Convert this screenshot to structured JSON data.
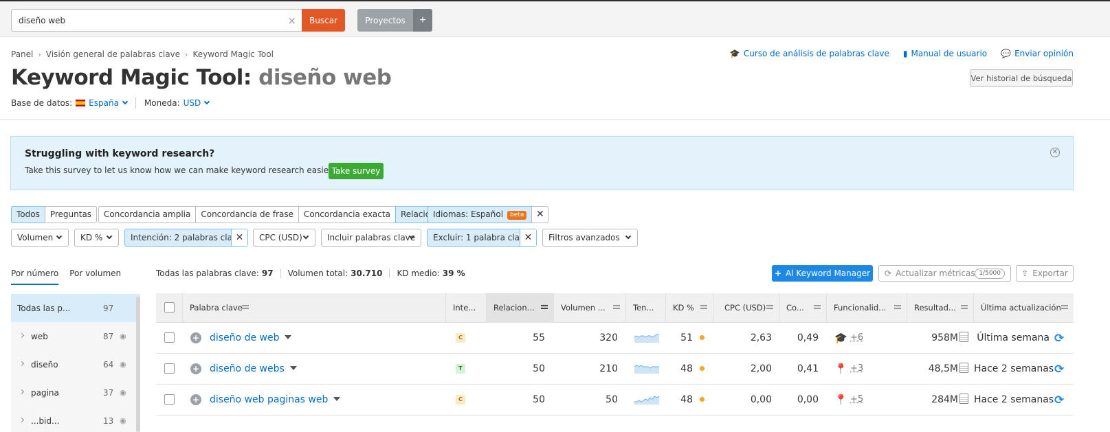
{
  "topbar": {
    "search_value": "diseño web",
    "search_button": "Buscar",
    "projects_button": "Proyectos",
    "plus_button": "+"
  },
  "breadcrumb": [
    "Panel",
    "Visión general de palabras clave",
    "Keyword Magic Tool"
  ],
  "top_links": {
    "course": "Curso de análisis de palabras clave",
    "manual": "Manual de usuario",
    "feedback": "Enviar opinión"
  },
  "title": {
    "tool": "Keyword Magic Tool:",
    "keyword": "diseño web"
  },
  "history_button": "Ver historial de búsqueda",
  "database": {
    "label": "Base de datos:",
    "value": "España",
    "currency_label": "Moneda:",
    "currency_value": "USD"
  },
  "banner": {
    "title": "Struggling with keyword research?",
    "text": "Take this survey to let us know how we can make keyword research easier for you.",
    "button": "Take survey"
  },
  "match_tabs": [
    "Todos",
    "Preguntas"
  ],
  "match_types": [
    "Concordancia amplia",
    "Concordancia de frase",
    "Concordancia exacta",
    "Relacionadas"
  ],
  "language_filter": {
    "label": "Idiomas: Español",
    "badge": "beta"
  },
  "filters": {
    "volume": "Volumen",
    "kd": "KD %",
    "intent": "Intención: 2 palabras clave",
    "cpc": "CPC (USD)",
    "include": "Incluir palabras clave",
    "exclude": "Excluir: 1 palabra clave",
    "advanced": "Filtros avanzados"
  },
  "left_tabs": [
    "Por número",
    "Por volumen"
  ],
  "groups": [
    {
      "label": "Todas las p...",
      "count": "97"
    },
    {
      "label": "web",
      "count": "87"
    },
    {
      "label": "diseño",
      "count": "64"
    },
    {
      "label": "pagina",
      "count": "37"
    },
    {
      "label": "...bid...",
      "count": "13"
    }
  ],
  "summary": {
    "all_label": "Todas las palabras clave:",
    "all_value": "97",
    "volume_label": "Volumen total:",
    "volume_value": "30.710",
    "kd_label": "KD medio:",
    "kd_value": "39 %"
  },
  "actions": {
    "keyword_manager": "Al Keyword Manager",
    "update_metrics": "Actualizar métricas",
    "quota": "1/5000",
    "export": "Exportar"
  },
  "columns": [
    "Palabra clave",
    "Inte...",
    "Relacion...",
    "Volumen ...",
    "Ten...",
    "KD %",
    "CPC (USD)",
    "Co...",
    "Funcionalid...",
    "Resultad...",
    "Última actualización"
  ],
  "rows": [
    {
      "keyword": "diseño de web",
      "intent": "C",
      "relevance": "55",
      "volume": "320",
      "kd": "51",
      "cpc": "2,63",
      "com": "0,49",
      "serp_icon": "graduation-cap-icon",
      "serp_more": "+6",
      "results": "958M",
      "updated": "Última semana",
      "trend": [
        4,
        5,
        4,
        5,
        5,
        4,
        5,
        5,
        4,
        5,
        6,
        6
      ]
    },
    {
      "keyword": "diseño de webs",
      "intent": "T",
      "relevance": "50",
      "volume": "210",
      "kd": "48",
      "cpc": "2,00",
      "com": "0,41",
      "serp_icon": "map-pin-icon",
      "serp_more": "+3",
      "results": "48,5M",
      "updated": "Hace 2 semanas",
      "trend": [
        5,
        6,
        5,
        6,
        5,
        5,
        5,
        4,
        5,
        5,
        5,
        5
      ]
    },
    {
      "keyword": "diseño web paginas web",
      "intent": "C",
      "relevance": "50",
      "volume": "50",
      "kd": "48",
      "cpc": "0,00",
      "com": "0,00",
      "serp_icon": "map-pin-icon",
      "serp_more": "+5",
      "results": "284M",
      "updated": "Hace 2 semanas",
      "trend": [
        2,
        2,
        3,
        2,
        3,
        4,
        3,
        5,
        4,
        6,
        5,
        6
      ]
    }
  ]
}
